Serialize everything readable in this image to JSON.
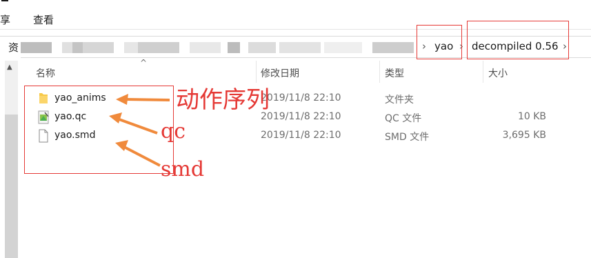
{
  "ribbon": {
    "tab_share": "享",
    "tab_view": "查看"
  },
  "address_bar": {
    "partial_label": "资",
    "crumbs": [
      "yao",
      "decompiled 0.56"
    ]
  },
  "columns": {
    "name": "名称",
    "date": "修改日期",
    "type": "类型",
    "size": "大小"
  },
  "files": [
    {
      "name": "yao_anims",
      "date": "2019/11/8 22:10",
      "type": "文件夹",
      "size": "",
      "icon": "folder-icon"
    },
    {
      "name": "yao.qc",
      "date": "2019/11/8 22:10",
      "type": "QC 文件",
      "size": "10 KB",
      "icon": "qc-file-icon"
    },
    {
      "name": "yao.smd",
      "date": "2019/11/8 22:10",
      "type": "SMD 文件",
      "size": "3,695 KB",
      "icon": "document-icon"
    }
  ],
  "annotations": {
    "anims": "动作序列",
    "qc": "qc",
    "smd": "smd"
  },
  "colors": {
    "annotation": "#e53935",
    "arrow": "#f08a3c"
  }
}
